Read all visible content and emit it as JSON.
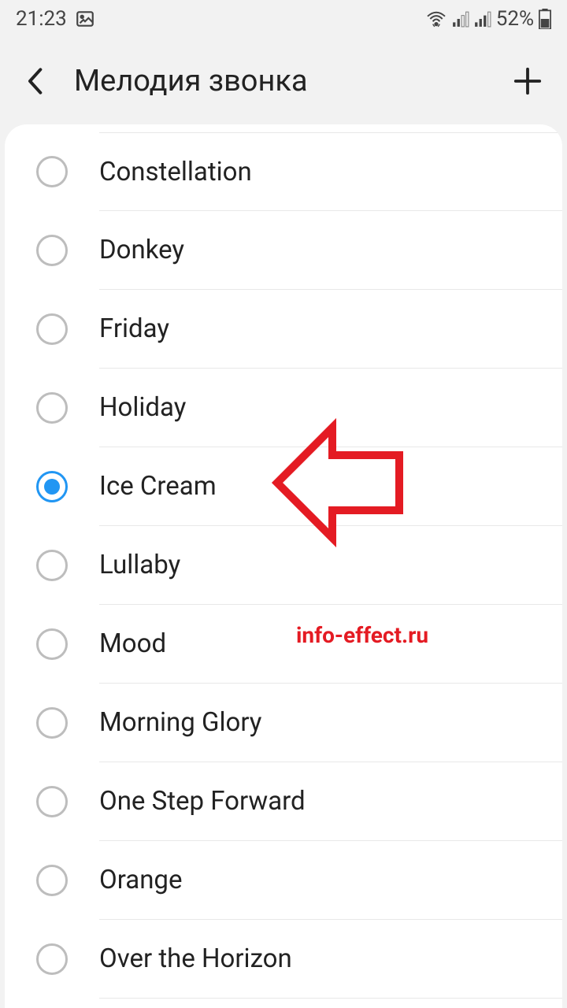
{
  "status": {
    "time": "21:23",
    "battery_text": "52%"
  },
  "header": {
    "title": "Мелодия звонка"
  },
  "ringtones": {
    "items": [
      {
        "label": "Constellation",
        "selected": false
      },
      {
        "label": "Donkey",
        "selected": false
      },
      {
        "label": "Friday",
        "selected": false
      },
      {
        "label": "Holiday",
        "selected": false
      },
      {
        "label": "Ice Cream",
        "selected": true
      },
      {
        "label": "Lullaby",
        "selected": false
      },
      {
        "label": "Mood",
        "selected": false
      },
      {
        "label": "Morning Glory",
        "selected": false
      },
      {
        "label": "One Step Forward",
        "selected": false
      },
      {
        "label": "Orange",
        "selected": false
      },
      {
        "label": "Over the Horizon",
        "selected": false
      }
    ]
  },
  "watermark": "info-effect.ru"
}
